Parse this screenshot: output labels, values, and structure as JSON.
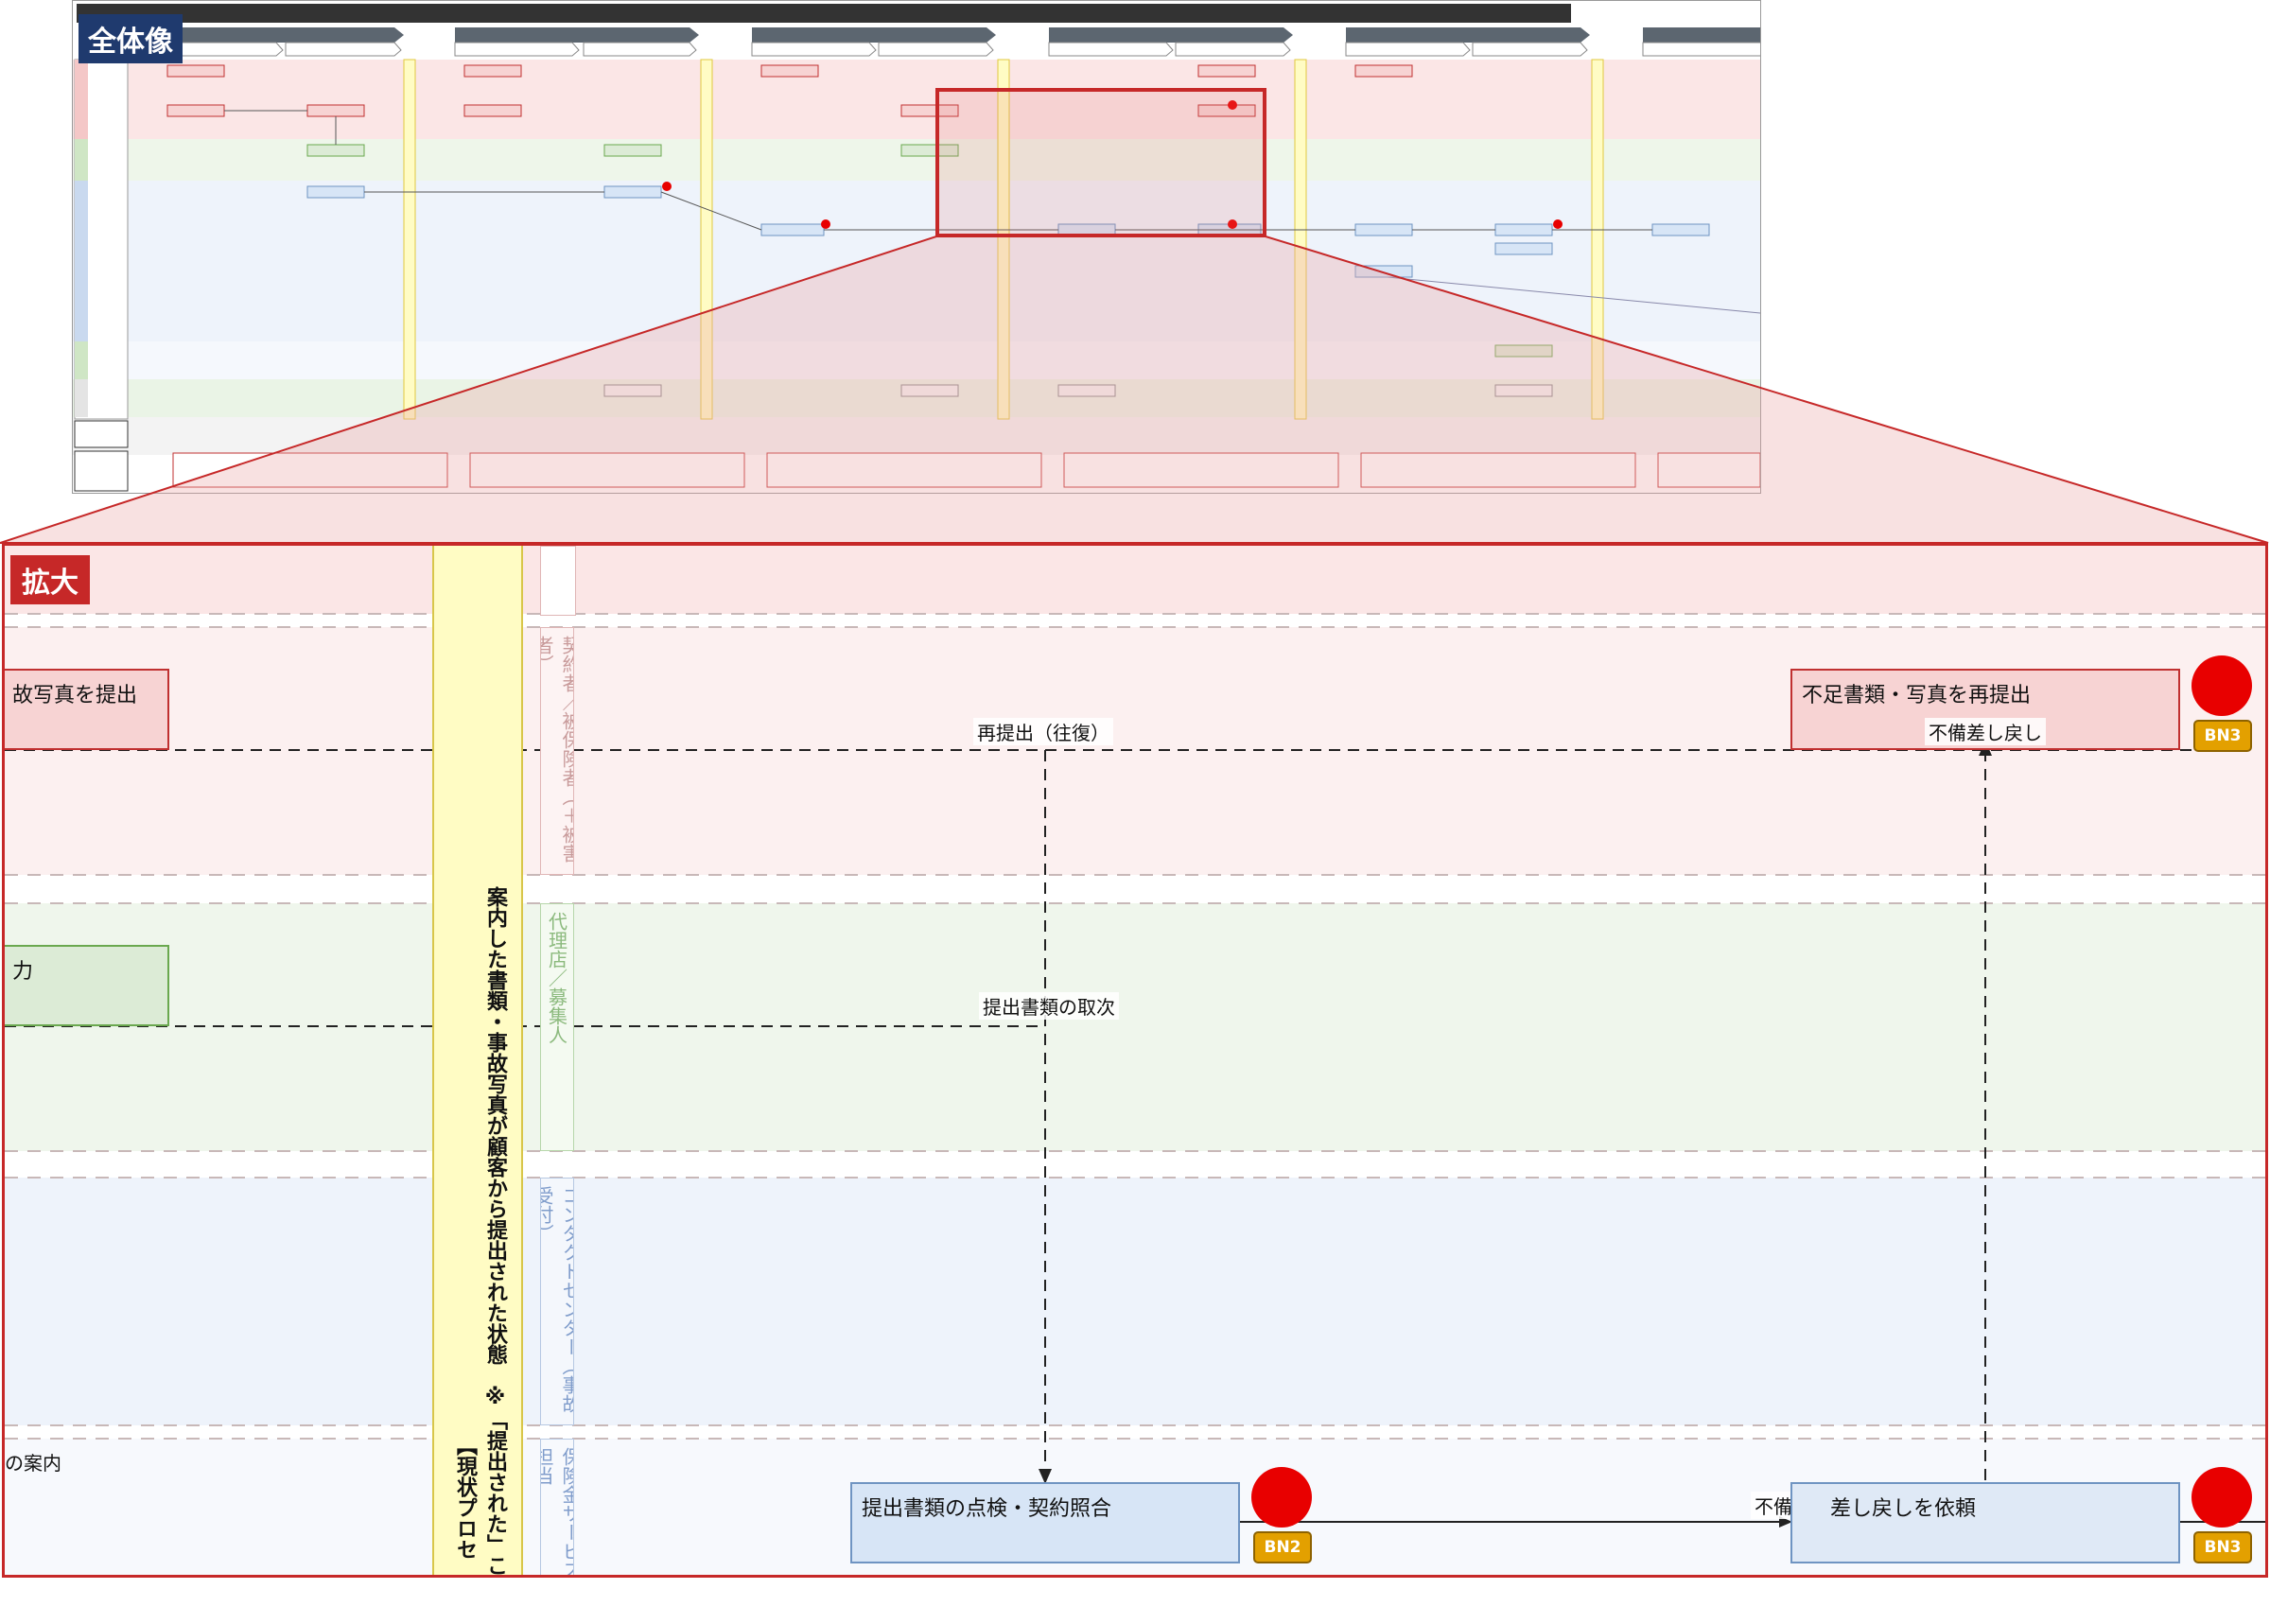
{
  "overview": {
    "badge": "全体像"
  },
  "zoom": {
    "badge": "拡大",
    "milestone_text": "案内した書類・事故写真が顧客から提出された状態　※「提出された」ことが",
    "milestone_text2": "【現状プロセ",
    "lanes": [
      {
        "label": "契約者／被保険者（＋被害者）"
      },
      {
        "label": "代理店／募集人"
      },
      {
        "label": "コンタクトセンター（事故受付）"
      },
      {
        "label": "保険金サービス担当"
      }
    ],
    "boxes": {
      "left_partial_red": "故写真を提出",
      "left_partial_green": "力",
      "left_partial_text": "の案内",
      "resubmit": "不足書類・写真を再提出",
      "check": "提出書類の点検・契約照合",
      "return_request": "差し戻しを依頼"
    },
    "labels": {
      "resubmit_loop": "再提出（往復）",
      "return_notice": "不備差し戻し",
      "relay": "提出書類の取次",
      "has_defect": "不備あり"
    },
    "badges": {
      "bn2": "BN2",
      "bn3": "BN3"
    }
  },
  "colors": {
    "accent_red": "#c62828",
    "navy": "#1f3a6e",
    "milestone": "#fffcc4",
    "bn_orange": "#e3a000"
  }
}
